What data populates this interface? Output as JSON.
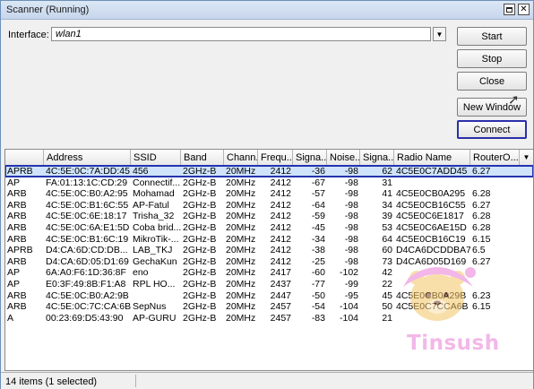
{
  "window": {
    "title": "Scanner (Running)"
  },
  "interface": {
    "label": "Interface:",
    "value": "wlan1"
  },
  "buttons": {
    "start": "Start",
    "stop": "Stop",
    "close": "Close",
    "new_window": "New Window",
    "connect": "Connect"
  },
  "table": {
    "columns": [
      "",
      "Address",
      "SSID",
      "Band",
      "Chann...",
      "Frequ...",
      "Signa...",
      "Noise...",
      "Signa...",
      "Radio Name",
      "RouterO..."
    ],
    "rows": [
      {
        "flags": "APRB",
        "address": "4C:5E:0C:7A:DD:45",
        "ssid": "456",
        "band": "2GHz-B",
        "channel": "20MHz",
        "freq": "2412",
        "signal": "-36",
        "noise": "-98",
        "snr": "62",
        "radio": "4C5E0C7ADD45",
        "router_os": "6.27",
        "selected": true
      },
      {
        "flags": "AP",
        "address": "FA:01:13:1C:CD:29",
        "ssid": "Connectif...",
        "band": "2GHz-B",
        "channel": "20MHz",
        "freq": "2412",
        "signal": "-67",
        "noise": "-98",
        "snr": "31",
        "radio": "",
        "router_os": "",
        "selected": false
      },
      {
        "flags": "ARB",
        "address": "4C:5E:0C:B0:A2:95",
        "ssid": "Mohamad",
        "band": "2GHz-B",
        "channel": "20MHz",
        "freq": "2412",
        "signal": "-57",
        "noise": "-98",
        "snr": "41",
        "radio": "4C5E0CB0A295",
        "router_os": "6.28",
        "selected": false
      },
      {
        "flags": "ARB",
        "address": "4C:5E:0C:B1:6C:55",
        "ssid": "AP-Fatul",
        "band": "2GHz-B",
        "channel": "20MHz",
        "freq": "2412",
        "signal": "-64",
        "noise": "-98",
        "snr": "34",
        "radio": "4C5E0CB16C55",
        "router_os": "6.27",
        "selected": false
      },
      {
        "flags": "ARB",
        "address": "4C:5E:0C:6E:18:17",
        "ssid": "Trisha_32",
        "band": "2GHz-B",
        "channel": "20MHz",
        "freq": "2412",
        "signal": "-59",
        "noise": "-98",
        "snr": "39",
        "radio": "4C5E0C6E1817",
        "router_os": "6.28",
        "selected": false
      },
      {
        "flags": "ARB",
        "address": "4C:5E:0C:6A:E1:5D",
        "ssid": "Coba brid...",
        "band": "2GHz-B",
        "channel": "20MHz",
        "freq": "2412",
        "signal": "-45",
        "noise": "-98",
        "snr": "53",
        "radio": "4C5E0C6AE15D",
        "router_os": "6.28",
        "selected": false
      },
      {
        "flags": "ARB",
        "address": "4C:5E:0C:B1:6C:19",
        "ssid": "MikroTik-...",
        "band": "2GHz-B",
        "channel": "20MHz",
        "freq": "2412",
        "signal": "-34",
        "noise": "-98",
        "snr": "64",
        "radio": "4C5E0CB16C19",
        "router_os": "6.15",
        "selected": false
      },
      {
        "flags": "APRB",
        "address": "D4:CA:6D:CD:DB...",
        "ssid": "LAB_TKJ",
        "band": "2GHz-B",
        "channel": "20MHz",
        "freq": "2412",
        "signal": "-38",
        "noise": "-98",
        "snr": "60",
        "radio": "D4CA6DCDDBA7",
        "router_os": "6.5",
        "selected": false
      },
      {
        "flags": "ARB",
        "address": "D4:CA:6D:05:D1:69",
        "ssid": "GechaKun",
        "band": "2GHz-B",
        "channel": "20MHz",
        "freq": "2412",
        "signal": "-25",
        "noise": "-98",
        "snr": "73",
        "radio": "D4CA6D05D169",
        "router_os": "6.27",
        "selected": false
      },
      {
        "flags": "AP",
        "address": "6A:A0:F6:1D:36:8F",
        "ssid": "eno",
        "band": "2GHz-B",
        "channel": "20MHz",
        "freq": "2417",
        "signal": "-60",
        "noise": "-102",
        "snr": "42",
        "radio": "",
        "router_os": "",
        "selected": false
      },
      {
        "flags": "AP",
        "address": "E0:3F:49:8B:F1:A8",
        "ssid": "RPL HO...",
        "band": "2GHz-B",
        "channel": "20MHz",
        "freq": "2437",
        "signal": "-77",
        "noise": "-99",
        "snr": "22",
        "radio": "",
        "router_os": "",
        "selected": false
      },
      {
        "flags": "ARB",
        "address": "4C:5E:0C:B0:A2:9B",
        "ssid": "",
        "band": "2GHz-B",
        "channel": "20MHz",
        "freq": "2447",
        "signal": "-50",
        "noise": "-95",
        "snr": "45",
        "radio": "4C5E0CB0A29B",
        "router_os": "6.23",
        "selected": false
      },
      {
        "flags": "ARB",
        "address": "4C:5E:0C:7C:CA:6B",
        "ssid": "SepNus",
        "band": "2GHz-B",
        "channel": "20MHz",
        "freq": "2457",
        "signal": "-54",
        "noise": "-104",
        "snr": "50",
        "radio": "4C5E0C7CCA6B",
        "router_os": "6.15",
        "selected": false
      },
      {
        "flags": "A",
        "address": "00:23:69:D5:43:90",
        "ssid": "AP-GURU",
        "band": "2GHz-B",
        "channel": "20MHz",
        "freq": "2457",
        "signal": "-83",
        "noise": "-104",
        "snr": "21",
        "radio": "",
        "router_os": "",
        "selected": false
      }
    ]
  },
  "status": {
    "text": "14 items (1 selected)"
  },
  "watermark": {
    "text": "Tinsush"
  },
  "icons": {
    "maximize": "maximize-icon",
    "close": "close-icon",
    "dropdown": "dropdown-arrow-icon",
    "cursor": "mouse-cursor-icon"
  },
  "colors": {
    "selection_border": "#2333b0",
    "selection_fill": "#cfe4fb",
    "watermark": "#e97cd6"
  }
}
